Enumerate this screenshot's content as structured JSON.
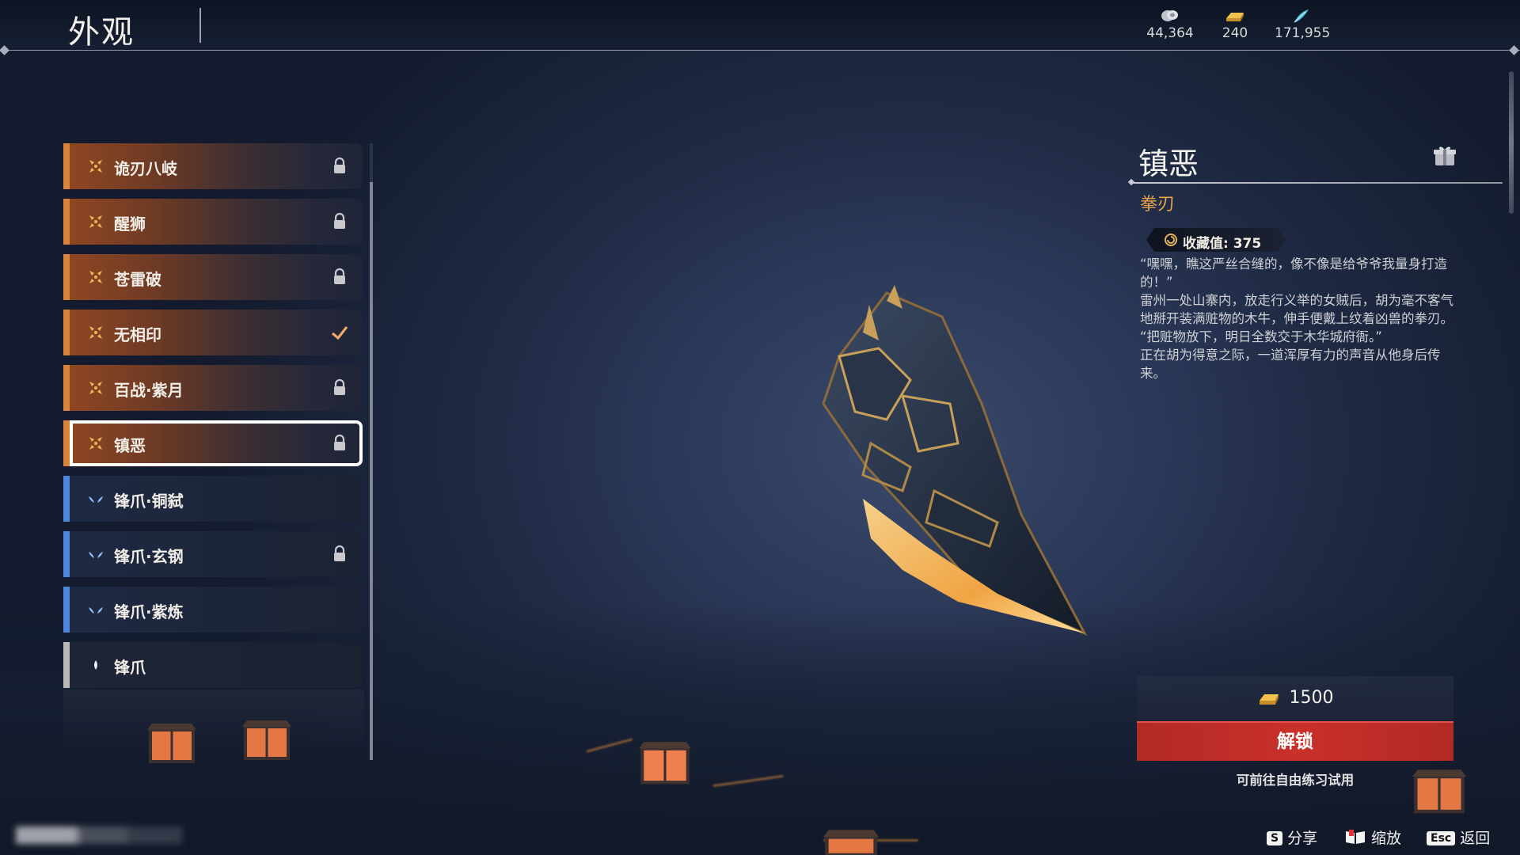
{
  "header": {
    "title": "外观",
    "currencies": [
      {
        "icon": "silver-coin-icon",
        "value": "44,364"
      },
      {
        "icon": "gold-ingot-icon",
        "value": "240"
      },
      {
        "icon": "feather-token-icon",
        "value": "171,955"
      }
    ]
  },
  "skins": [
    {
      "name": "诡刃八岐",
      "rarity": "orange",
      "status": "locked"
    },
    {
      "name": "醒狮",
      "rarity": "orange",
      "status": "locked"
    },
    {
      "name": "苍雷破",
      "rarity": "orange",
      "status": "locked"
    },
    {
      "name": "无相印",
      "rarity": "orange",
      "status": "equipped"
    },
    {
      "name": "百战·紫月",
      "rarity": "orange",
      "status": "locked"
    },
    {
      "name": "镇恶",
      "rarity": "orange",
      "status": "locked",
      "selected": true
    },
    {
      "name": "锋爪·铜弑",
      "rarity": "blue",
      "status": "owned"
    },
    {
      "name": "锋爪·玄钢",
      "rarity": "blue",
      "status": "locked"
    },
    {
      "name": "锋爪·紫炼",
      "rarity": "blue",
      "status": "owned"
    },
    {
      "name": "锋爪",
      "rarity": "white",
      "status": "owned"
    }
  ],
  "detail": {
    "name": "镇恶",
    "type": "拳刃",
    "collect_label": "收藏值: 375",
    "description": [
      "“嘿嘿，瞧这严丝合缝的，像不像是给爷爷我量身打造的！”",
      "雷州一处山寨内，放走行义举的女贼后，胡为毫不客气地掰开装满赃物的木牛，伸手便戴上纹着凶兽的拳刃。",
      "“把赃物放下，明日全数交于木华城府衙。”",
      "正在胡为得意之际，一道浑厚有力的声音从他身后传来。"
    ]
  },
  "purchase": {
    "price": "1500",
    "unlock_label": "解锁",
    "trial_note": "可前往自由练习试用"
  },
  "hints": [
    {
      "key": "S",
      "label": "分享"
    },
    {
      "key": "book-icon",
      "label": "缩放"
    },
    {
      "key": "Esc",
      "label": "返回"
    }
  ],
  "colors": {
    "orange_rarity": "#d7853a",
    "blue_rarity": "#4f86d9",
    "white_rarity": "#b8b8b8",
    "unlock_red": "#c02d28",
    "type_gold": "#e9a24a"
  }
}
